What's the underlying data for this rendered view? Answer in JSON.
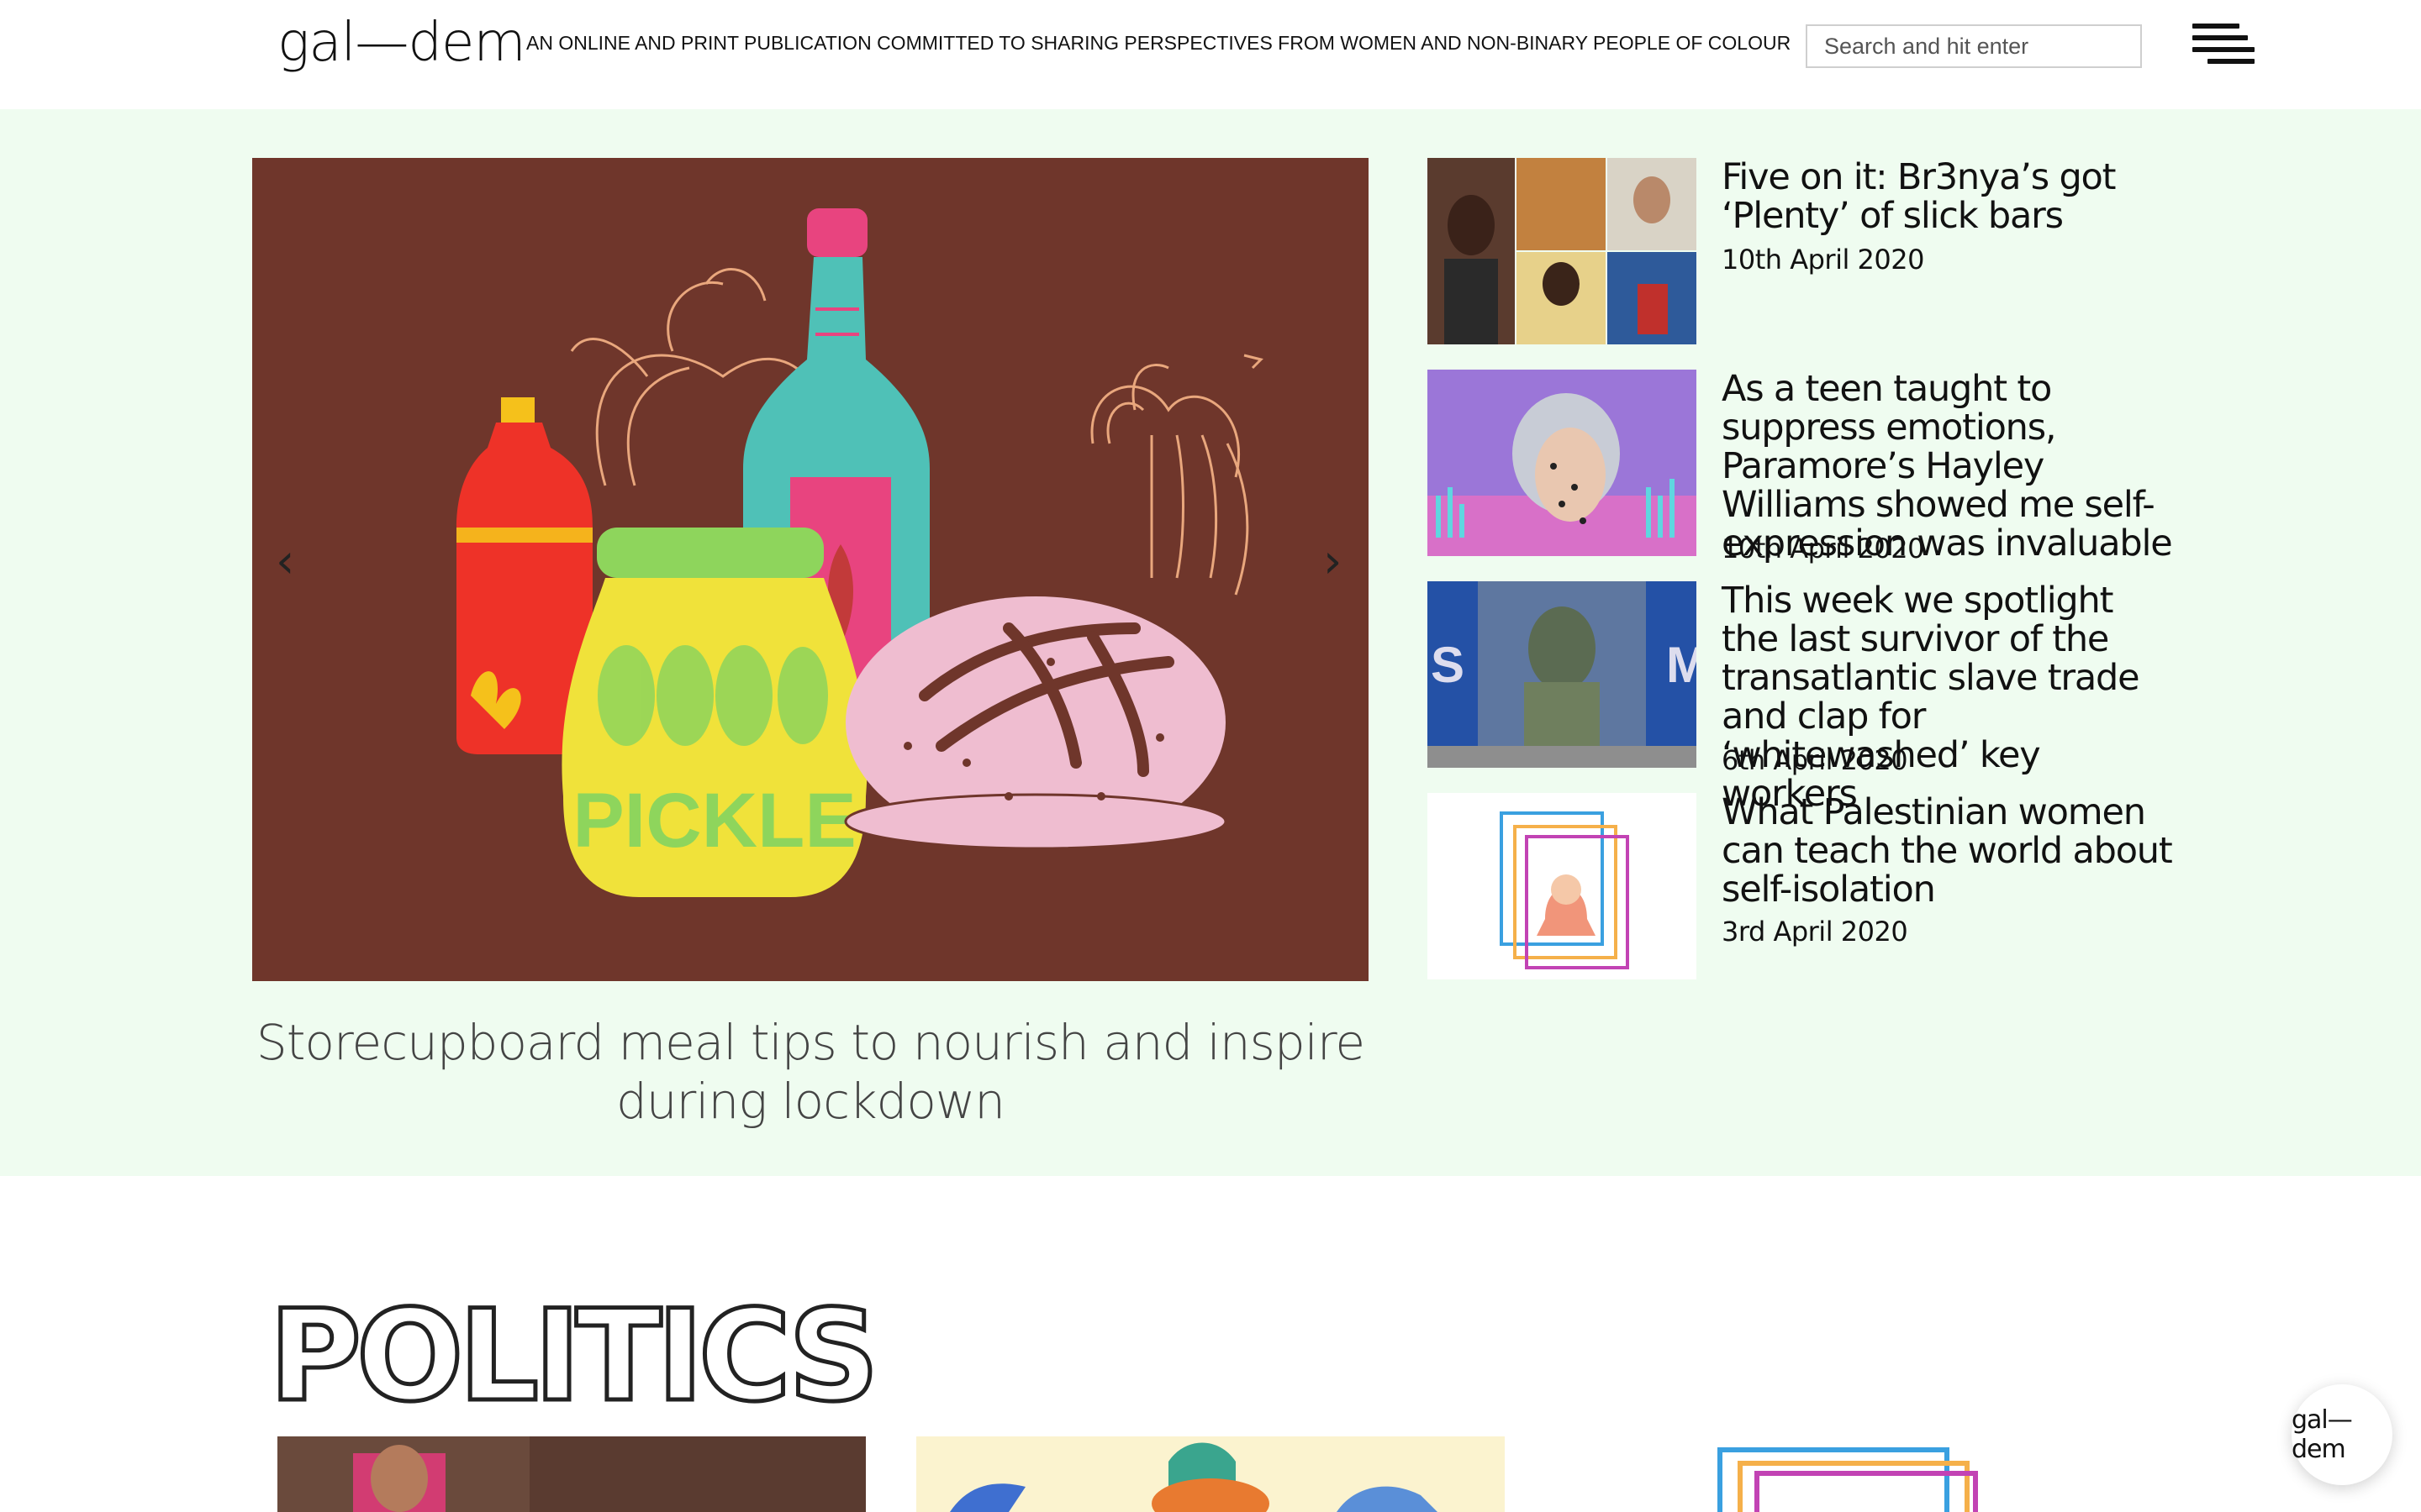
{
  "header": {
    "logo": "gal—dem",
    "tagline": "AN ONLINE AND PRINT PUBLICATION COMMITTED TO SHARING PERSPECTIVES FROM WOMEN AND NON-BINARY PEOPLE OF COLOUR",
    "search_placeholder": "Search and hit enter",
    "menu_icon": "hamburger-menu-icon"
  },
  "feature": {
    "title": "Storecupboard meal tips to nourish and inspire during lockdown",
    "prev_arrow": "‹",
    "next_arrow": "›",
    "image_label": "PICKLE"
  },
  "side_articles": [
    {
      "title": "Five on it: Br3nya’s got ‘Plenty’ of slick bars",
      "date": "10th April 2020"
    },
    {
      "title": "As a teen taught to suppress emotions, Paramore’s Hayley Williams showed me self-expression was invaluable",
      "date": "10th April 2020"
    },
    {
      "title": "This week we spotlight the last survivor of the transatlantic slave trade and clap for ‘whitewashed’ key workers",
      "date": "6th April 2020"
    },
    {
      "title": "What Palestinian women can teach the world about self-isolation",
      "date": "3rd April 2020"
    }
  ],
  "sections": {
    "politics_title": "POLITICS"
  },
  "fab": {
    "label": "gal—dem"
  },
  "colors": {
    "hero_background": "#effcf0",
    "slide_background": "#6f362b"
  }
}
